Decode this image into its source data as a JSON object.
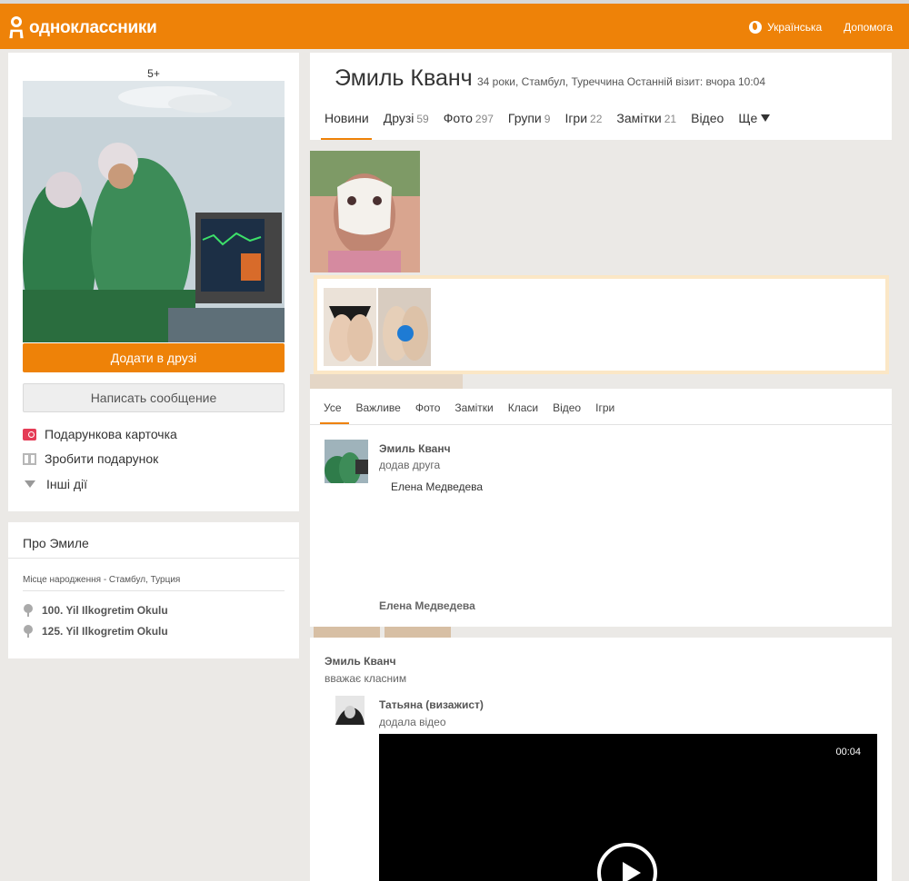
{
  "header": {
    "logo_text": "одноклассники",
    "language": "Українська",
    "help": "Допомога"
  },
  "left": {
    "photo_count": "5+",
    "add_friend": "Додати в друзі",
    "write_message": "Написать сообщение",
    "actions": [
      {
        "label": "Подарункова карточка",
        "icon": "gift-card-icon"
      },
      {
        "label": "Зробити подарунок",
        "icon": "gift-icon"
      },
      {
        "label": "Інші дії",
        "icon": "triangle-down-icon"
      }
    ],
    "about": {
      "title": "Про Эмиле",
      "birthplace": "Місце народження - Стамбул, Турция",
      "schools": [
        "100. Yil Ilkogretim Okulu",
        "125. Yil Ilkogretim Okulu"
      ]
    }
  },
  "profile": {
    "name": "Эмиль Кванч",
    "meta": "34 роки, Стамбул, Туреччина  Останній візит: вчора 10:04",
    "tabs": [
      {
        "label": "Новини",
        "count": ""
      },
      {
        "label": "Друзі",
        "count": "59"
      },
      {
        "label": "Фото",
        "count": "297"
      },
      {
        "label": "Групи",
        "count": "9"
      },
      {
        "label": "Ігри",
        "count": "22"
      },
      {
        "label": "Замітки",
        "count": "21"
      },
      {
        "label": "Відео",
        "count": ""
      },
      {
        "label": "Ще",
        "count": ""
      }
    ]
  },
  "feed": {
    "tabs": [
      "Усе",
      "Важливе",
      "Фото",
      "Замітки",
      "Класи",
      "Відео",
      "Ігри"
    ],
    "post1": {
      "author": "Эмиль Кванч",
      "action": "додав друга",
      "friend": "Елена Медведева",
      "friend_bottom": "Елена Медведева"
    },
    "post2": {
      "author": "Эмиль Кванч",
      "action": "вважає класним",
      "sub_author": "Татьяна (визажист)",
      "sub_action": "додала відео",
      "video_time": "00:04"
    }
  },
  "colors": {
    "brand": "#ee8208",
    "background": "#ebe9e6"
  }
}
